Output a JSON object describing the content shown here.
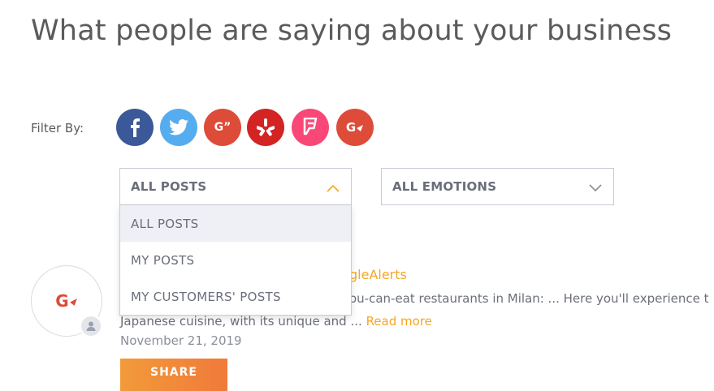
{
  "page": {
    "title": "What people are saying about your business"
  },
  "filter": {
    "label": "Filter By:",
    "networks": [
      {
        "name": "facebook",
        "color": "#3b5998",
        "icon": "facebook-icon"
      },
      {
        "name": "twitter",
        "color": "#55acee",
        "icon": "twitter-icon"
      },
      {
        "name": "google-my-business",
        "color": "#dd4b39",
        "icon": "google-plus-quote-icon",
        "glyph": "G”"
      },
      {
        "name": "yelp",
        "color": "#d32323",
        "icon": "yelp-icon"
      },
      {
        "name": "foursquare",
        "color": "#f94877",
        "icon": "foursquare-icon"
      },
      {
        "name": "google-alerts",
        "color": "#dd4b39",
        "icon": "google-alerts-icon",
        "glyph": "G"
      }
    ]
  },
  "posts_select": {
    "selected": "ALL POSTS",
    "options": [
      "ALL POSTS",
      "MY POSTS",
      "MY CUSTOMERS' POSTS"
    ],
    "active_index": 0
  },
  "emotions_select": {
    "selected": "ALL EMOTIONS"
  },
  "post": {
    "avatar_glyph": "G",
    "source_visible": "gleAlerts",
    "text_line1_visible": "ou-can-eat restaurants in Milan: ... Here you'll experience t",
    "text_line2": "Japanese cuisine, with its unique and ...",
    "read_more": "Read more",
    "date": "November 21, 2019",
    "share_label": "SHARE"
  },
  "colors": {
    "accent": "#f5a623",
    "text": "#5b5b5b"
  }
}
